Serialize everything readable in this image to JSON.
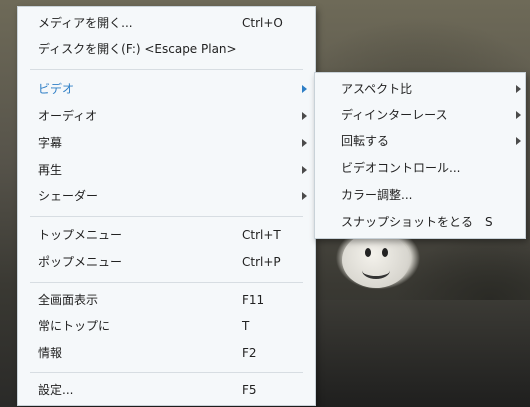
{
  "main_menu": {
    "items": [
      {
        "label": "メディアを開く...",
        "shortcut": "Ctrl+O"
      },
      {
        "label": "ディスクを開く(F:) <Escape Plan>",
        "shortcut": ""
      },
      {
        "label": "ビデオ",
        "shortcut": ""
      },
      {
        "label": "オーディオ",
        "shortcut": ""
      },
      {
        "label": "字幕",
        "shortcut": ""
      },
      {
        "label": "再生",
        "shortcut": ""
      },
      {
        "label": "シェーダー",
        "shortcut": ""
      },
      {
        "label": "トップメニュー",
        "shortcut": "Ctrl+T"
      },
      {
        "label": "ポップメニュー",
        "shortcut": "Ctrl+P"
      },
      {
        "label": "全画面表示",
        "shortcut": "F11"
      },
      {
        "label": "常にトップに",
        "shortcut": "T"
      },
      {
        "label": "情報",
        "shortcut": "F2"
      },
      {
        "label": "設定...",
        "shortcut": "F5"
      }
    ]
  },
  "video_submenu": {
    "items": [
      {
        "label": "アスペクト比",
        "shortcut": ""
      },
      {
        "label": "ディインターレース",
        "shortcut": ""
      },
      {
        "label": "回転する",
        "shortcut": ""
      },
      {
        "label": "ビデオコントロール...",
        "shortcut": ""
      },
      {
        "label": "カラー調整...",
        "shortcut": ""
      },
      {
        "label": "スナップショットをとる",
        "shortcut": "S"
      }
    ]
  },
  "colors": {
    "menu_bg": "#f5f8fa",
    "active_text": "#2f7fc6",
    "separator": "#d7dde2"
  },
  "icons": [
    "submenu-arrow-icon"
  ]
}
